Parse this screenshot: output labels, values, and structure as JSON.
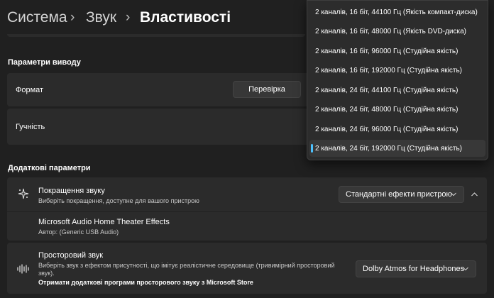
{
  "breadcrumb": {
    "items": [
      "Система",
      "Звук",
      "Властивості"
    ],
    "separator": "›"
  },
  "output_params": {
    "title": "Параметри виводу",
    "format_label": "Формат",
    "test_button": "Перевірка",
    "volume_label": "Гучність"
  },
  "format_dropdown": {
    "options": [
      "2 каналів, 16 біт, 44100 Гц (Якість компакт-диска)",
      "2 каналів, 16 біт, 48000 Гц (Якість DVD-диска)",
      "2 каналів, 16 біт, 96000 Гц (Студійна якість)",
      "2 каналів, 16 біт, 192000 Гц (Студійна якість)",
      "2 каналів, 24 біт, 44100 Гц (Студійна якість)",
      "2 каналів, 24 біт, 48000 Гц (Студійна якість)",
      "2 каналів, 24 біт, 96000 Гц (Студійна якість)",
      "2 каналів, 24 біт, 192000 Гц (Студійна якість)"
    ],
    "selected_index": 7
  },
  "additional": {
    "title": "Додаткові параметри",
    "enhancement": {
      "title": "Покращення звуку",
      "subtitle": "Виберіть покращення, доступне для вашого пристрою",
      "selected": "Стандартні ефекти пристрою",
      "icon": "sparkle-icon"
    },
    "effect": {
      "title": "Microsoft Audio Home Theater Effects",
      "author": "Автор: (Generic USB Audio)"
    },
    "spatial": {
      "title": "Просторовий звук",
      "desc_line1": "Виберіть звук з ефектом присутності, що імітує реалістичне середовище (тривимірний просторовий",
      "desc_line2": "звук).",
      "store_link": "Отримати додаткові програми просторового звуку з Microsoft Store",
      "selected": "Dolby Atmos for Headphones",
      "icon": "spatial-audio-icon"
    }
  },
  "colors": {
    "background": "#202020",
    "card": "#2b2b2b",
    "accent": "#4cc2ff"
  }
}
